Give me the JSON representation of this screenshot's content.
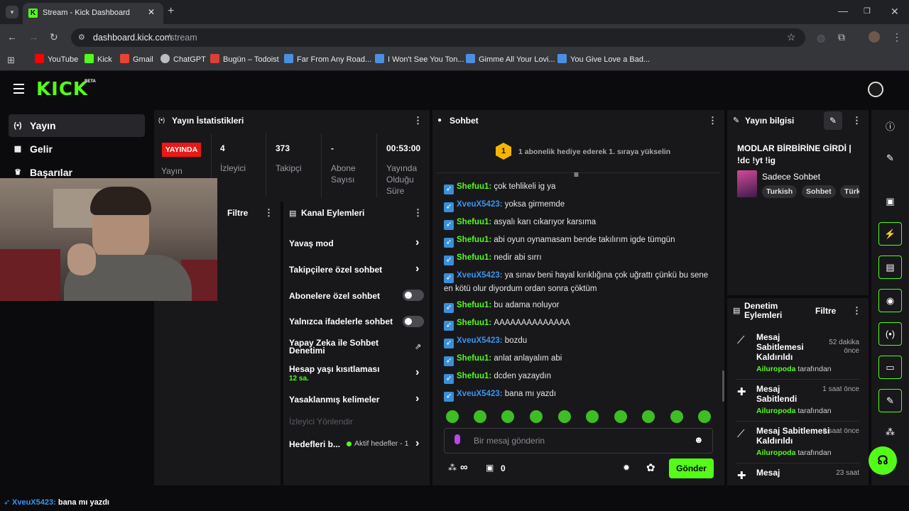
{
  "browser": {
    "tab_title": "Stream - Kick Dashboard",
    "url_domain": "dashboard.kick.com",
    "url_path": "/stream",
    "bookmarks": [
      {
        "label": "YouTube",
        "color": "#ff0000"
      },
      {
        "label": "Kick",
        "color": "#53fc18"
      },
      {
        "label": "Gmail",
        "color": "#ea4335"
      },
      {
        "label": "ChatGPT",
        "color": "#bdbdbd"
      },
      {
        "label": "Bugün – Todoist",
        "color": "#db4035"
      },
      {
        "label": "Far From Any Road...",
        "color": "#4a90e2"
      },
      {
        "label": "I Won't See You Ton...",
        "color": "#4a90e2"
      },
      {
        "label": "Gimme All Your Lovi...",
        "color": "#4a90e2"
      },
      {
        "label": "You Give Love a Bad...",
        "color": "#4a90e2"
      }
    ]
  },
  "kick": {
    "logo": "KICK",
    "logo_badge": "BETA",
    "brand_color": "#53fc18",
    "nav": [
      {
        "label": "Yayın",
        "icon": "broadcast-icon"
      },
      {
        "label": "Gelir",
        "icon": "revenue-icon"
      },
      {
        "label": "Başarılar",
        "icon": "trophy-icon"
      }
    ]
  },
  "stats": {
    "title": "Yayın İstatistikleri",
    "live_badge": "YAYINDA",
    "live_label": "Yayın",
    "items": [
      {
        "value": "4",
        "label": "İzleyici"
      },
      {
        "value": "373",
        "label": "Takipçi"
      },
      {
        "value": "-",
        "label": "Abone Sayısı"
      },
      {
        "value": "00:53:00",
        "label": "Yayında Olduğu Süre"
      }
    ]
  },
  "filter_panel": {
    "title": "Filtre"
  },
  "actions": {
    "title": "Kanal Eylemleri",
    "items": [
      {
        "label": "Yavaş mod",
        "sub": ""
      },
      {
        "label": "Takipçilere özel sohbet",
        "sub": ""
      },
      {
        "label": "Abonelere özel sohbet",
        "sub": ""
      },
      {
        "label": "Yalnızca ifadelerle sohbet",
        "sub": ""
      },
      {
        "label": "Yapay Zeka ile Sohbet Denetimi",
        "sub": ""
      },
      {
        "label": "Hesap yaşı kısıtlaması",
        "sub": "12 sa."
      },
      {
        "label": "Yasaklanmış kelimeler",
        "sub": ""
      },
      {
        "label": "İzleyici Yönlendir",
        "sub": ""
      },
      {
        "label": "Hedefleri b...",
        "sub": "Aktif hedefler - 1"
      }
    ]
  },
  "chat": {
    "title": "Sohbet",
    "gift_rank": "1",
    "gift_text": "1 abonelik hediye ederek 1. sıraya yükselin",
    "messages": [
      {
        "user": "Shefuu1",
        "text": "çok tehlikeli ig ya",
        "color": "green"
      },
      {
        "user": "XveuX5423",
        "text": "yoksa girmemde",
        "color": "blue"
      },
      {
        "user": "Shefuu1",
        "text": "asyalı karı cıkarıyor karsıma",
        "color": "green"
      },
      {
        "user": "Shefuu1",
        "text": "abi oyun oynamasam bende takılırım igde tümgün",
        "color": "green"
      },
      {
        "user": "Shefuu1",
        "text": "nedir abi sırrı",
        "color": "green"
      },
      {
        "user": "XveuX5423",
        "text": "ya sınav beni hayal kırıklığına çok uğrattı çünkü bu sene en kötü olur diyordum ordan sonra çöktüm",
        "color": "blue"
      },
      {
        "user": "Shefuu1",
        "text": "bu adama noluyor",
        "color": "green"
      },
      {
        "user": "Shefuu1",
        "text": "AAAAAAAAAAAAAA",
        "color": "green"
      },
      {
        "user": "XveuX5423",
        "text": "bozdu",
        "color": "blue"
      },
      {
        "user": "Shefuu1",
        "text": "anlat anlayalım abi",
        "color": "green"
      },
      {
        "user": "Shefuu1",
        "text": "dcden yazaydın",
        "color": "green"
      },
      {
        "user": "XveuX5423",
        "text": "bana mı yazdı",
        "color": "blue"
      }
    ],
    "input_placeholder": "Bir mesaj gönderin",
    "points": "∞",
    "chest_count": "0",
    "send_label": "Gönder"
  },
  "stream_info": {
    "title": "Yayın bilgisi",
    "stream_title": "MODLAR BİRBİRİNE GİRDİ | !dc !yt !ig",
    "category": "Sadece Sohbet",
    "tags": [
      "Turkish",
      "Sohbet",
      "Türk"
    ]
  },
  "moderation": {
    "title": "Denetim Eylemleri",
    "filter_label": "Filtre",
    "by_label": "tarafından",
    "items": [
      {
        "action": "Mesaj Sabitlemesi Kaldırıldı",
        "user": "Ailuropoda",
        "time": "52 dakika önce",
        "icon": "unpin-icon"
      },
      {
        "action": "Mesaj Sabitlendi",
        "user": "Ailuropoda",
        "time": "1 saat önce",
        "icon": "pin-icon"
      },
      {
        "action": "Mesaj Sabitlemesi Kaldırıldı",
        "user": "Ailuropoda",
        "time": "6 saat önce",
        "icon": "unpin-icon"
      },
      {
        "action": "Mesaj",
        "user": "",
        "time": "23 saat",
        "icon": "pin-icon"
      }
    ]
  },
  "bottom_bar": {
    "user": "XveuX5423",
    "text": "bana mı yazdı"
  }
}
